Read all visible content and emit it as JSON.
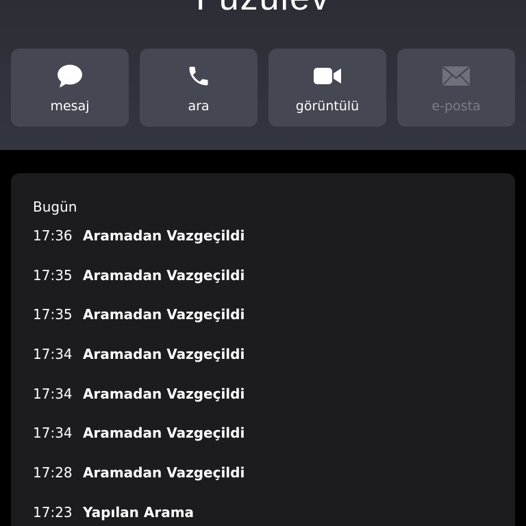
{
  "contact": {
    "name": "Fuzulev"
  },
  "actions": [
    {
      "label": "mesaj",
      "icon": "message-bubble-icon",
      "enabled": true
    },
    {
      "label": "ara",
      "icon": "phone-icon",
      "enabled": true
    },
    {
      "label": "görüntülü",
      "icon": "video-camera-icon",
      "enabled": true
    },
    {
      "label": "e-posta",
      "icon": "envelope-icon",
      "enabled": false
    }
  ],
  "history": {
    "heading": "Bugün",
    "items": [
      {
        "time": "17:36",
        "status": "Aramadan Vazgeçildi"
      },
      {
        "time": "17:35",
        "status": "Aramadan Vazgeçildi"
      },
      {
        "time": "17:35",
        "status": "Aramadan Vazgeçildi"
      },
      {
        "time": "17:34",
        "status": "Aramadan Vazgeçildi"
      },
      {
        "time": "17:34",
        "status": "Aramadan Vazgeçildi"
      },
      {
        "time": "17:34",
        "status": "Aramadan Vazgeçildi"
      },
      {
        "time": "17:28",
        "status": "Aramadan Vazgeçildi"
      },
      {
        "time": "17:23",
        "status": "Yapılan Arama"
      }
    ]
  },
  "colors": {
    "header_background": "#30333b",
    "action_button": "#454852",
    "card_background": "#1c1c1e",
    "disabled_text": "#7b7e86"
  }
}
